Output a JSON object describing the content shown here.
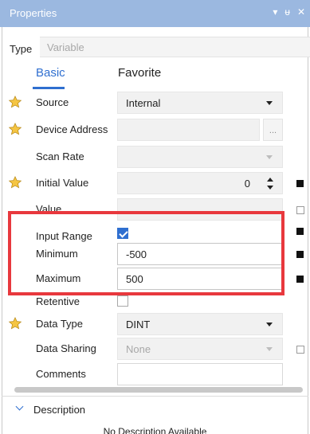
{
  "panel": {
    "title": "Properties",
    "icons": {
      "dropdown": "▾",
      "pin": "ᵾ",
      "close": "✕"
    }
  },
  "type_row": {
    "label": "Type",
    "value": "Variable"
  },
  "tabs": [
    {
      "label": "Basic",
      "active": true
    },
    {
      "label": "Favorite",
      "active": false
    }
  ],
  "properties": {
    "source": {
      "label": "Source",
      "value": "Internal",
      "starred": true
    },
    "device_address": {
      "label": "Device Address",
      "value": "",
      "button_label": "...",
      "starred": true
    },
    "scan_rate": {
      "label": "Scan Rate",
      "value": ""
    },
    "initial_value": {
      "label": "Initial Value",
      "value": "0",
      "starred": true
    },
    "value": {
      "label": "Value",
      "value": ""
    },
    "input_range": {
      "label": "Input Range",
      "checked": true
    },
    "minimum": {
      "label": "Minimum",
      "value": "-500"
    },
    "maximum": {
      "label": "Maximum",
      "value": "500"
    },
    "retentive": {
      "label": "Retentive",
      "checked": false
    },
    "data_type": {
      "label": "Data Type",
      "value": "DINT",
      "starred": true
    },
    "data_sharing": {
      "label": "Data Sharing",
      "value": "None"
    },
    "comments": {
      "label": "Comments",
      "value": ""
    }
  },
  "description": {
    "header": "Description",
    "text": "No Description Available"
  },
  "colors": {
    "accent": "#2f6fd0",
    "titlebar": "#9bb8e0",
    "highlight": "#e8383d",
    "star": "#f5c542"
  }
}
